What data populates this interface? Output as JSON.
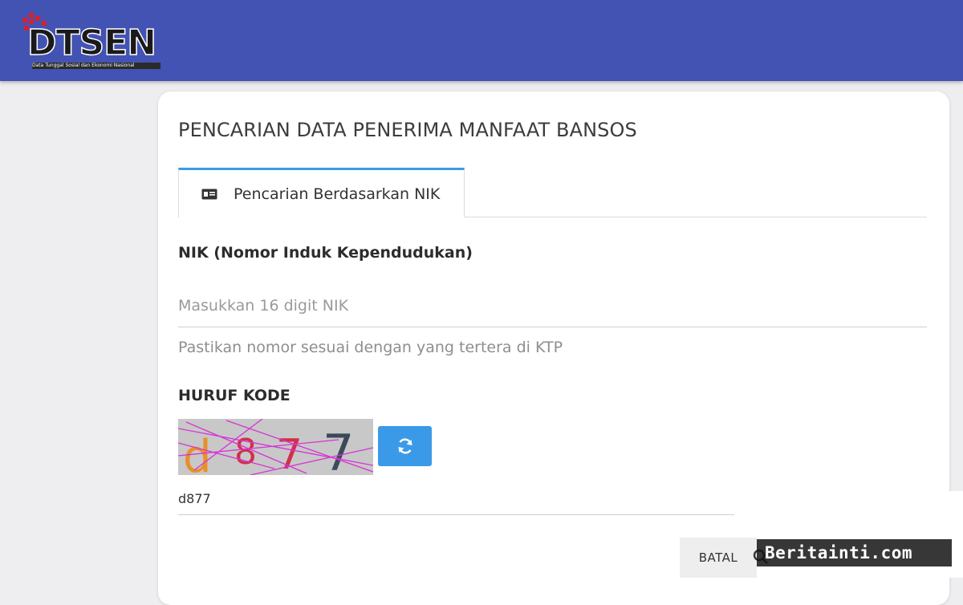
{
  "header": {
    "logo_text": "DTSEN",
    "logo_subtitle": "Data Tunggal Sosial dan Ekonomi Nasional",
    "background": "#4353b4"
  },
  "card": {
    "title": "PENCARIAN DATA PENERIMA MANFAAT BANSOS"
  },
  "tabs": [
    {
      "label": "Pencarian Berdasarkan NIK",
      "icon": "id-card-icon",
      "active": true
    }
  ],
  "nik_field": {
    "label": "NIK (Nomor Induk Kependudukan)",
    "placeholder": "Masukkan 16 digit NIK",
    "value": "",
    "hint": "Pastikan nomor sesuai dengan yang tertera di KTP"
  },
  "captcha": {
    "label": "HURUF KODE",
    "characters": [
      "d",
      "8",
      "7",
      "7"
    ],
    "input_value": "d877",
    "refresh_icon": "refresh-icon",
    "refresh_color": "#3a9ae8"
  },
  "actions": {
    "cancel_label": "BATAL",
    "search_icon": "search-icon"
  },
  "watermark": {
    "text": "Beritainti.com"
  }
}
